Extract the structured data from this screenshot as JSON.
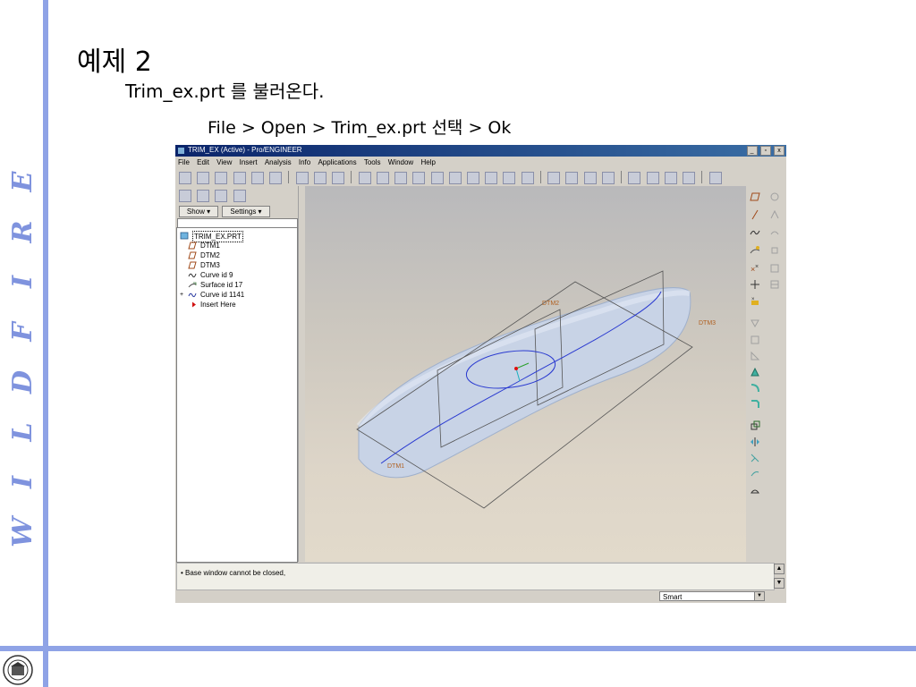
{
  "slide": {
    "title": "예제 2",
    "subtitle": "Trim_ex.prt 를 불러온다.",
    "instruction": "File > Open > Trim_ex.prt  선택 > Ok",
    "vertical_word": [
      "E",
      "R",
      "I",
      "F",
      "D",
      "L",
      "I",
      "W"
    ],
    "accent_color": "#8fa3e6"
  },
  "app": {
    "title": "TRIM_EX (Active) - Pro/ENGINEER",
    "window_buttons": [
      "_",
      "▫",
      "x"
    ],
    "menu": [
      "File",
      "Edit",
      "View",
      "Insert",
      "Analysis",
      "Info",
      "Applications",
      "Tools",
      "Window",
      "Help"
    ],
    "tabs": {
      "show": "Show ▾",
      "settings": "Settings ▾"
    },
    "tree": [
      {
        "label": "TRIM_EX.PRT",
        "icon": "part-icon"
      },
      {
        "label": "DTM1",
        "icon": "datum-plane-icon"
      },
      {
        "label": "DTM2",
        "icon": "datum-plane-icon"
      },
      {
        "label": "DTM3",
        "icon": "datum-plane-icon"
      },
      {
        "label": "Curve id 9",
        "icon": "curve-icon"
      },
      {
        "label": "Surface id 17",
        "icon": "surface-icon"
      },
      {
        "label": "Curve id 1141",
        "icon": "curve-icon"
      },
      {
        "label": "Insert Here",
        "icon": "insert-arrow-icon"
      }
    ],
    "viewport_labels": {
      "dtm1": "DTM1",
      "dtm2": "DTM2",
      "dtm3": "DTM3"
    },
    "message": "• Base window cannot be closed,",
    "filter": "Smart"
  }
}
